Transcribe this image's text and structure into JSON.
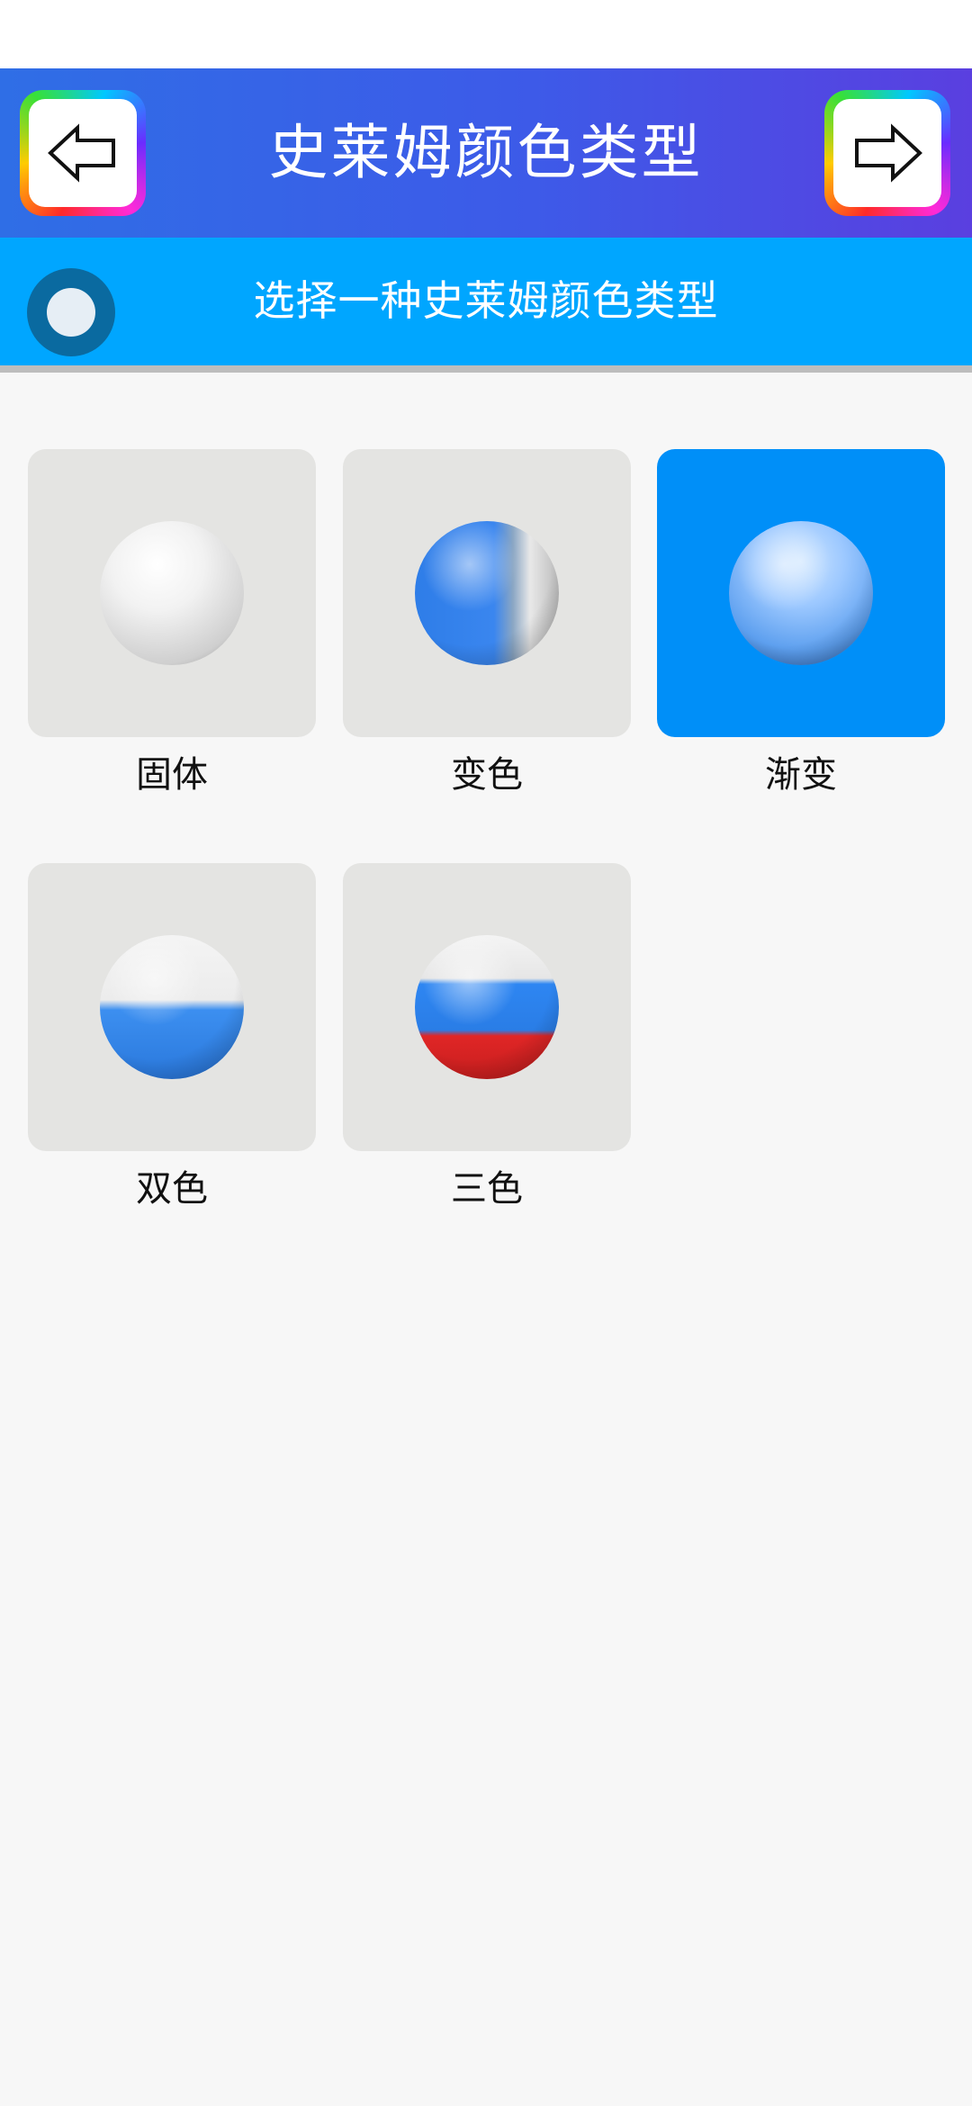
{
  "header": {
    "title": "史莱姆颜色类型",
    "back_icon": "arrow-left-icon",
    "next_icon": "arrow-right-icon"
  },
  "subheader": {
    "icon": "circle-icon",
    "title": "选择一种史莱姆颜色类型"
  },
  "options": [
    {
      "label": "固体",
      "icon": "solid-ball-icon",
      "selected": false
    },
    {
      "label": "变色",
      "icon": "color-change-ball-icon",
      "selected": false
    },
    {
      "label": "渐变",
      "icon": "gradient-ball-icon",
      "selected": true
    },
    {
      "label": "双色",
      "icon": "two-color-ball-icon",
      "selected": false
    },
    {
      "label": "三色",
      "icon": "three-color-ball-icon",
      "selected": false
    }
  ],
  "colors": {
    "header_start": "#2f6ee6",
    "header_end": "#5a3fe0",
    "subheader": "#00a6ff",
    "tile": "#e4e4e2",
    "tile_selected": "#008ff8"
  }
}
